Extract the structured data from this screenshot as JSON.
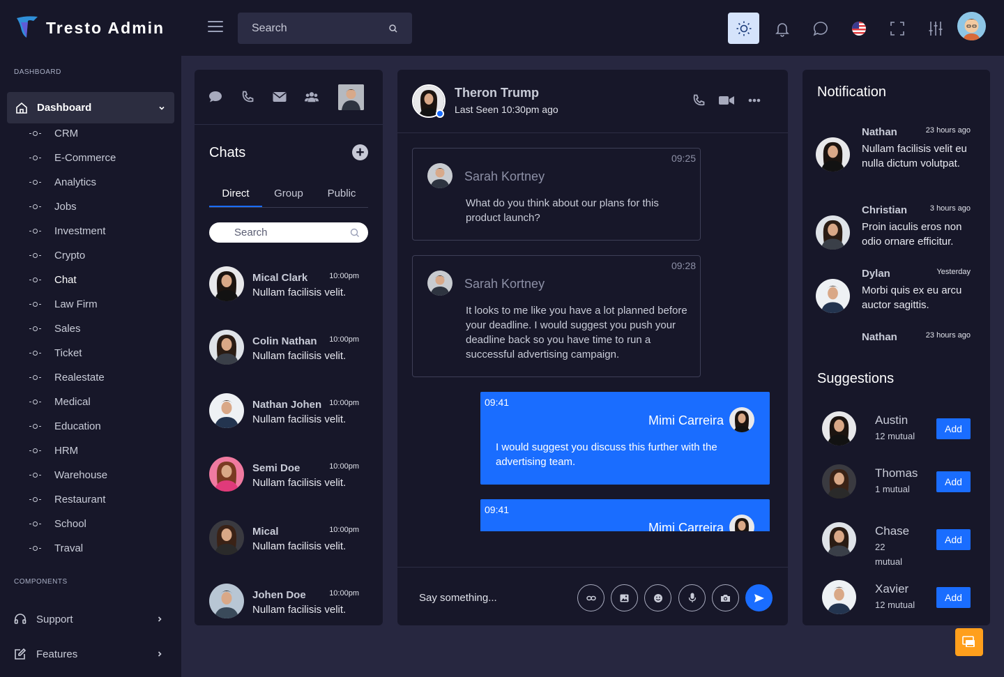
{
  "brand": {
    "name": "Tresto Admin"
  },
  "topbar": {
    "search_placeholder": "Search"
  },
  "sidebar": {
    "section1": "DASHBOARD",
    "dashboard_label": "Dashboard",
    "items": [
      "CRM",
      "E-Commerce",
      "Analytics",
      "Jobs",
      "Investment",
      "Crypto",
      "Chat",
      "Law Firm",
      "Sales",
      "Ticket",
      "Realestate",
      "Medical",
      "Education",
      "HRM",
      "Warehouse",
      "Restaurant",
      "School",
      "Traval"
    ],
    "active_item": "Chat",
    "section2": "COMPONENTS",
    "bottom_items": [
      "Support",
      "Features"
    ]
  },
  "chat_list": {
    "title": "Chats",
    "tabs": [
      "Direct",
      "Group",
      "Public"
    ],
    "active_tab": "Direct",
    "search_placeholder": "Search",
    "contacts": [
      {
        "name": "Mical Clark",
        "time": "10:00pm",
        "message": "Nullam facilisis velit."
      },
      {
        "name": "Colin Nathan",
        "time": "10:00pm",
        "message": "Nullam facilisis velit."
      },
      {
        "name": "Nathan Johen",
        "time": "10:00pm",
        "message": "Nullam facilisis velit."
      },
      {
        "name": "Semi Doe",
        "time": "10:00pm",
        "message": "Nullam facilisis velit."
      },
      {
        "name": "Mical",
        "time": "10:00pm",
        "message": "Nullam facilisis velit."
      },
      {
        "name": "Johen Doe",
        "time": "10:00pm",
        "message": "Nullam facilisis velit."
      }
    ]
  },
  "chat": {
    "contact_name": "Theron Trump",
    "last_seen": "Last Seen 10:30pm ago",
    "messages": [
      {
        "time": "09:25",
        "sender": "Sarah Kortney",
        "text": "What do you think about our plans for this product launch?"
      },
      {
        "time": "09:28",
        "sender": "Sarah Kortney",
        "text": "It looks to me like you have a lot planned before your deadline. I would suggest you push your deadline back so you have time to run a successful advertising campaign."
      },
      {
        "time": "09:41",
        "sender": "Mimi Carreira",
        "text": "I would suggest you discuss this further with the advertising team."
      },
      {
        "time": "09:41",
        "sender": "Mimi Carreira"
      }
    ],
    "input_placeholder": "Say something..."
  },
  "notifications": {
    "title": "Notification",
    "items": [
      {
        "name": "Nathan",
        "time": "23 hours ago",
        "text": "Nullam facilisis velit eu nulla dictum volutpat."
      },
      {
        "name": "Christian",
        "time": "3 hours ago",
        "text": "Proin iaculis eros non odio ornare efficitur."
      },
      {
        "name": "Dylan",
        "time": "Yesterday",
        "text": "Morbi quis ex eu arcu auctor sagittis."
      },
      {
        "name": "Nathan",
        "time": "23 hours ago"
      }
    ]
  },
  "suggestions": {
    "title": "Suggestions",
    "add_label": "Add",
    "items": [
      {
        "name": "Austin",
        "mutual": "12 mutual"
      },
      {
        "name": "Thomas",
        "mutual": "1 mutual"
      },
      {
        "name": "Chase",
        "mutual_count": "22",
        "mutual_word": "mutual"
      },
      {
        "name": "Xavier",
        "mutual": "12 mutual"
      }
    ]
  },
  "colors": {
    "accent": "#1a6dff",
    "background": "#272740",
    "panel": "#171729",
    "float_button": "#ff9f1c"
  }
}
